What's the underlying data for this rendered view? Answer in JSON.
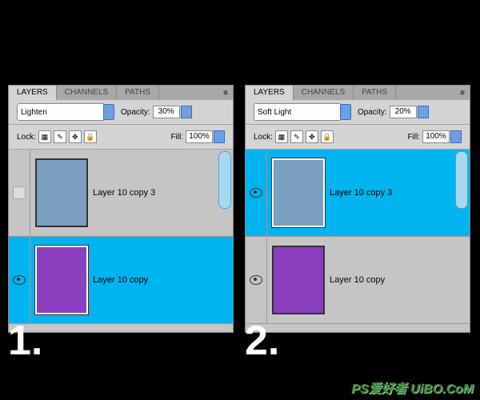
{
  "tabs": {
    "layers": "LAYERS",
    "channels": "CHANNELS",
    "paths": "PATHS"
  },
  "labels": {
    "opacity": "Opacity:",
    "fill": "Fill:",
    "lock": "Lock:"
  },
  "icons": {
    "menu": "≡",
    "lock_trans": "▦",
    "lock_brush": "✎",
    "lock_move": "✥",
    "lock_all": "🔒",
    "arrow": "▸"
  },
  "panel1": {
    "blend": "Lighten",
    "opacity": "30%",
    "fill": "100%",
    "layers": [
      {
        "name": "Layer 10 copy 3",
        "visible": false,
        "selected": false,
        "swatch": "blue"
      },
      {
        "name": "Layer 10 copy",
        "visible": true,
        "selected": true,
        "swatch": "purple"
      }
    ]
  },
  "panel2": {
    "blend": "Soft Light",
    "opacity": "20%",
    "fill": "100%",
    "layers": [
      {
        "name": "Layer 10 copy 3",
        "visible": true,
        "selected": true,
        "swatch": "blue"
      },
      {
        "name": "Layer 10 copy",
        "visible": true,
        "selected": false,
        "swatch": "purple"
      }
    ]
  },
  "numbers": {
    "one": "1.",
    "two": "2."
  },
  "watermark": "PS爱好者 UiBO.CoM"
}
